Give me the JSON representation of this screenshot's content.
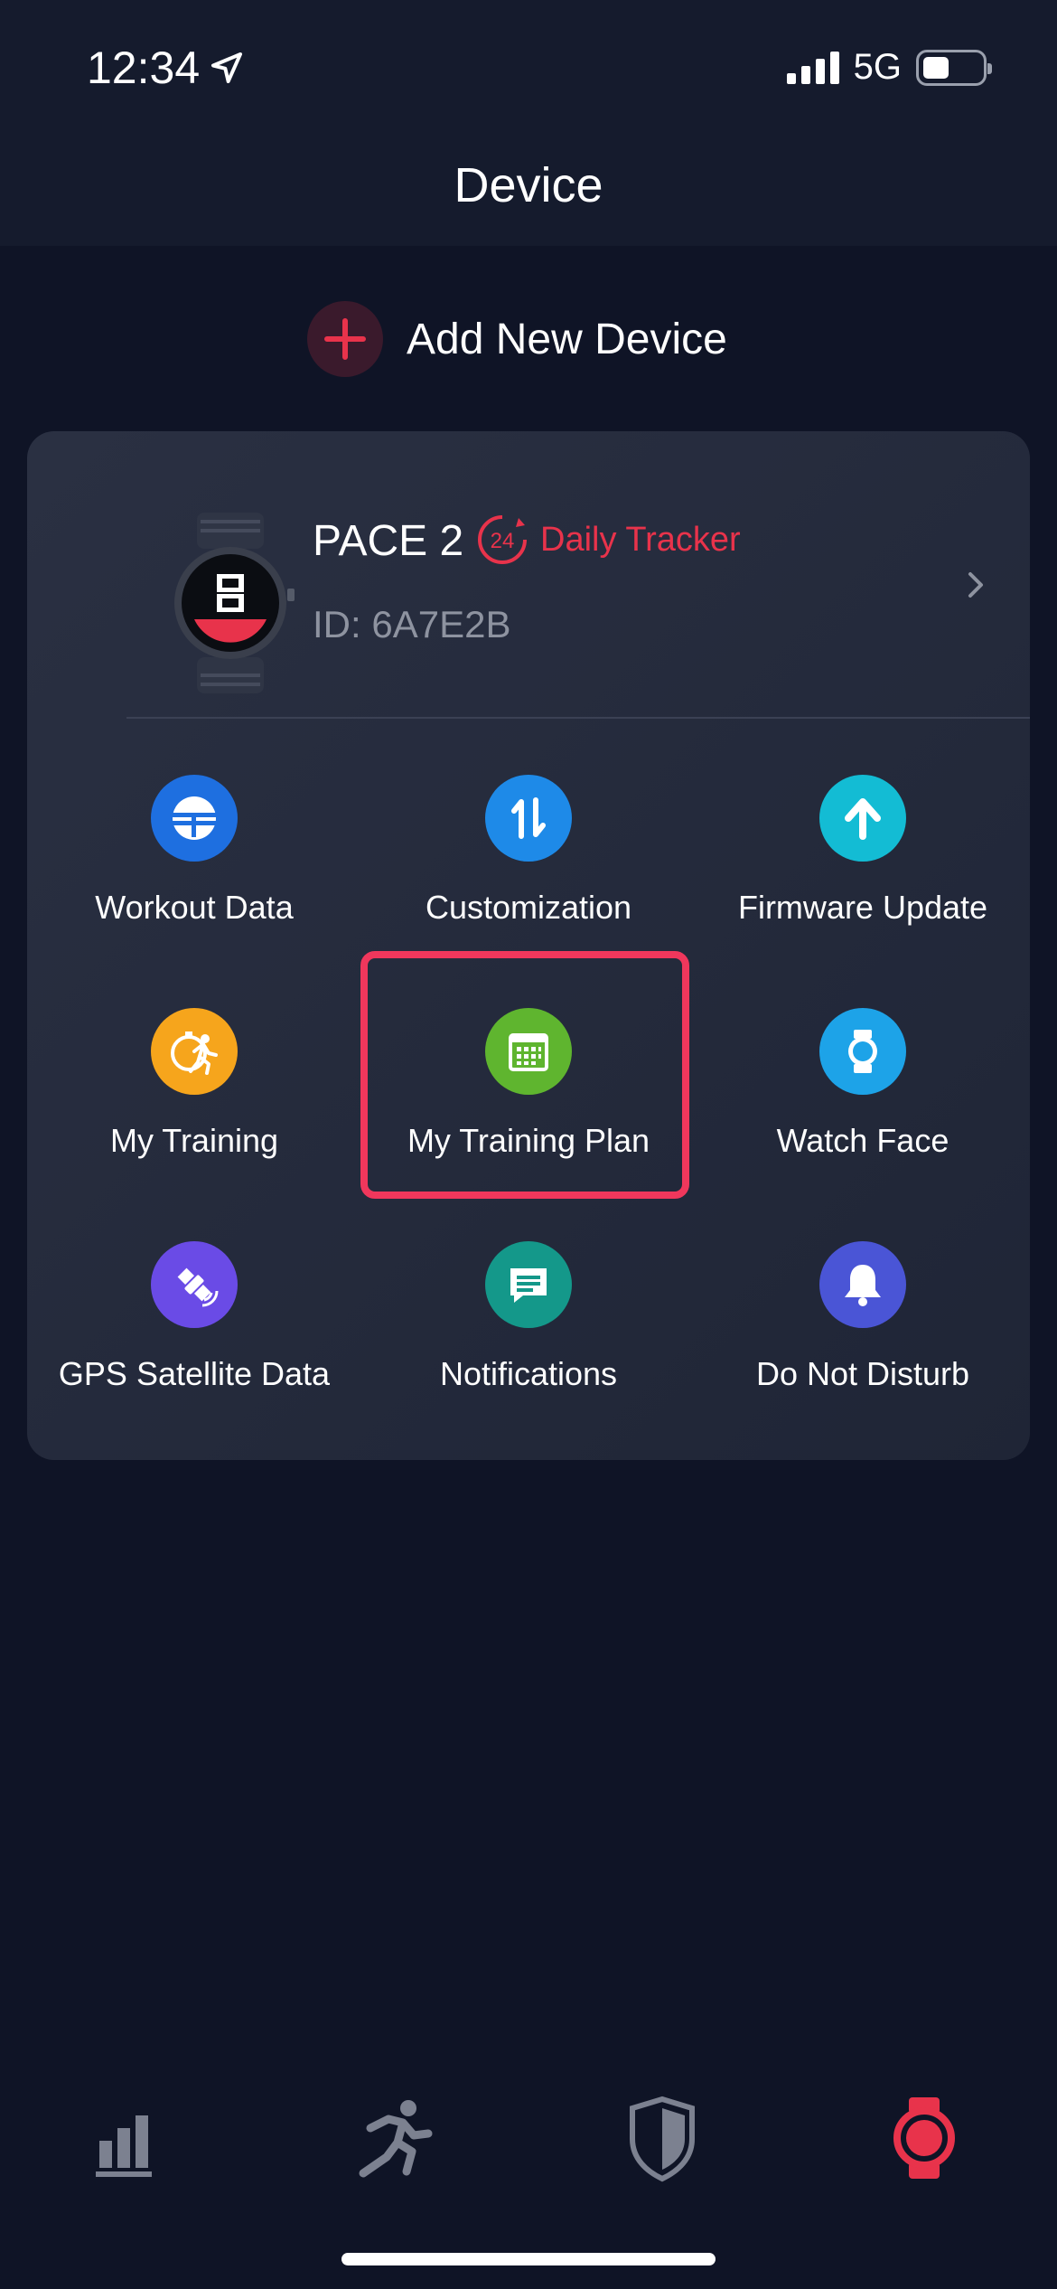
{
  "status_bar": {
    "time": "12:34",
    "network": "5G"
  },
  "header": {
    "title": "Device"
  },
  "add_device": {
    "label": "Add New Device"
  },
  "device": {
    "name": "PACE 2",
    "badge_number": "24",
    "badge_label": "Daily Tracker",
    "id": "ID: 6A7E2B"
  },
  "features": [
    {
      "label": "Workout Data",
      "icon": "workout-data-icon",
      "color": "#1e6fe0"
    },
    {
      "label": "Customization",
      "icon": "customization-icon",
      "color": "#1e8ae8"
    },
    {
      "label": "Firmware Update",
      "icon": "firmware-update-icon",
      "color": "#13bcd4"
    },
    {
      "label": "My Training",
      "icon": "my-training-icon",
      "color": "#f6a51c"
    },
    {
      "label": "My Training Plan",
      "icon": "calendar-icon",
      "color": "#5fb52f"
    },
    {
      "label": "Watch Face",
      "icon": "watch-face-icon",
      "color": "#1da3e8"
    },
    {
      "label": "GPS Satellite Data",
      "icon": "satellite-icon",
      "color": "#6a4be6"
    },
    {
      "label": "Notifications",
      "icon": "notifications-icon",
      "color": "#14988a"
    },
    {
      "label": "Do Not Disturb",
      "icon": "bell-icon",
      "color": "#4a55d6"
    }
  ],
  "tabbar": [
    "stats-tab",
    "activity-tab",
    "shield-tab",
    "device-tab"
  ],
  "colors": {
    "accent": "#e8334b",
    "background": "#0f1426",
    "card": "#262c3e"
  }
}
